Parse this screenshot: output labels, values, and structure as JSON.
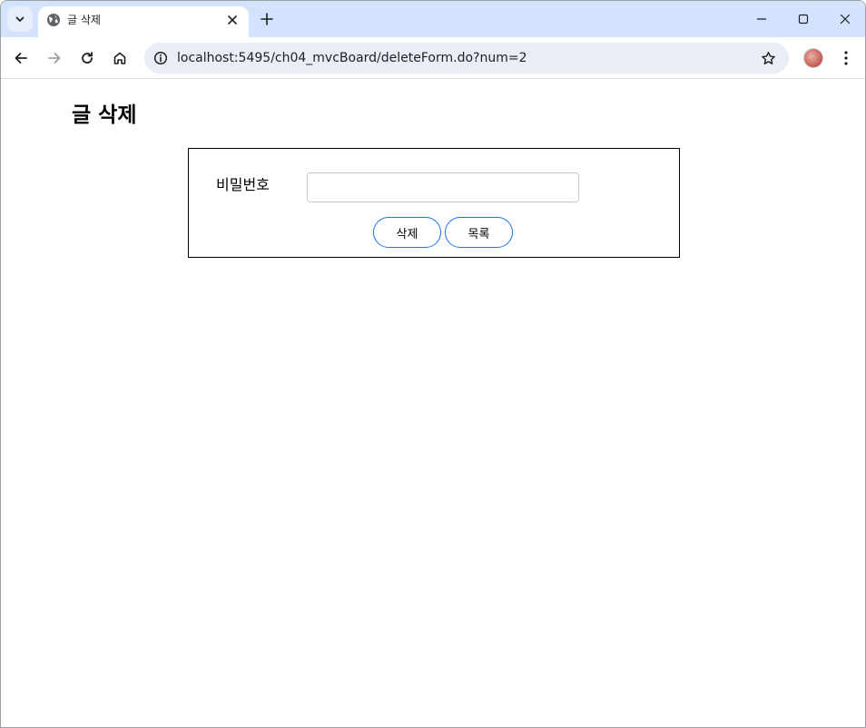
{
  "browser": {
    "tab": {
      "title": "글 삭제",
      "favicon": "globe-icon"
    },
    "url": "localhost:5495/ch04_mvcBoard/deleteForm.do?num=2",
    "accent_color": "#d3e3fd"
  },
  "page": {
    "title": "글 삭제",
    "form": {
      "password_label": "비밀번호",
      "password_value": "",
      "delete_button": "삭제",
      "list_button": "목록",
      "button_border_color": "#1a73e8"
    }
  }
}
